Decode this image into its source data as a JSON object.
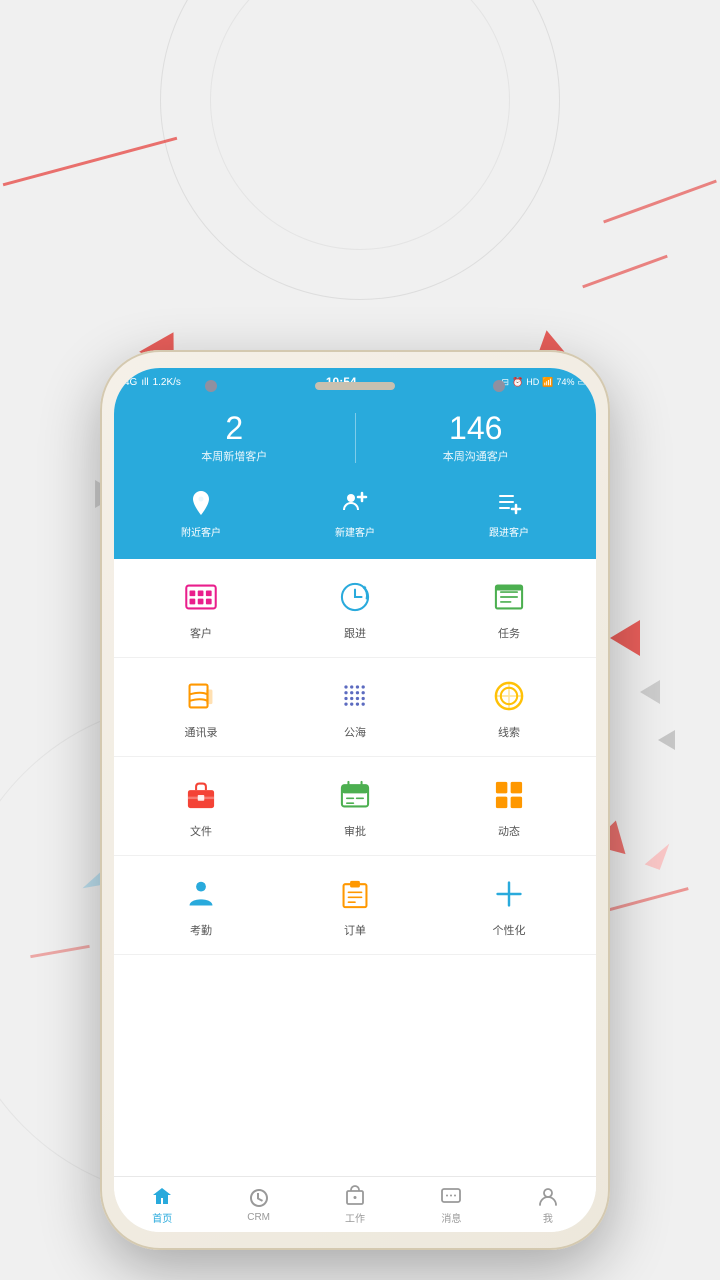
{
  "background": {
    "color": "#eaeaea"
  },
  "statusBar": {
    "network": "4G",
    "signal": "4G ıl",
    "speed": "1.2K/s",
    "time": "10:54",
    "battery": "74%",
    "hd": "HD"
  },
  "stats": [
    {
      "number": "2",
      "label": "本周新增客户"
    },
    {
      "number": "146",
      "label": "本周沟通客户"
    }
  ],
  "quickActions": [
    {
      "label": "附近客户",
      "icon": "location"
    },
    {
      "label": "新建客户",
      "icon": "add-person"
    },
    {
      "label": "跟进客户",
      "icon": "add-list"
    }
  ],
  "gridRows": [
    [
      {
        "label": "客户",
        "icon": "customer",
        "color": "#e91e8c"
      },
      {
        "label": "跟进",
        "icon": "followup",
        "color": "#29aadc"
      },
      {
        "label": "任务",
        "icon": "task",
        "color": "#4caf50"
      }
    ],
    [
      {
        "label": "通讯录",
        "icon": "contacts",
        "color": "#ff9800"
      },
      {
        "label": "公海",
        "icon": "sea",
        "color": "#5c6bc0"
      },
      {
        "label": "线索",
        "icon": "clue",
        "color": "#ffc107"
      }
    ],
    [
      {
        "label": "文件",
        "icon": "file",
        "color": "#f44336"
      },
      {
        "label": "审批",
        "icon": "approval",
        "color": "#4caf50"
      },
      {
        "label": "动态",
        "icon": "dynamic",
        "color": "#ff9800"
      }
    ],
    [
      {
        "label": "考勤",
        "icon": "attendance",
        "color": "#29aadc"
      },
      {
        "label": "订单",
        "icon": "order",
        "color": "#ff9800"
      },
      {
        "label": "个性化",
        "icon": "customize",
        "color": "#29aadc"
      }
    ]
  ],
  "bottomNav": [
    {
      "label": "首页",
      "active": true,
      "icon": "home"
    },
    {
      "label": "CRM",
      "active": false,
      "icon": "crm"
    },
    {
      "label": "工作",
      "active": false,
      "icon": "work"
    },
    {
      "label": "消息",
      "active": false,
      "icon": "message"
    },
    {
      "label": "我",
      "active": false,
      "icon": "me"
    }
  ]
}
